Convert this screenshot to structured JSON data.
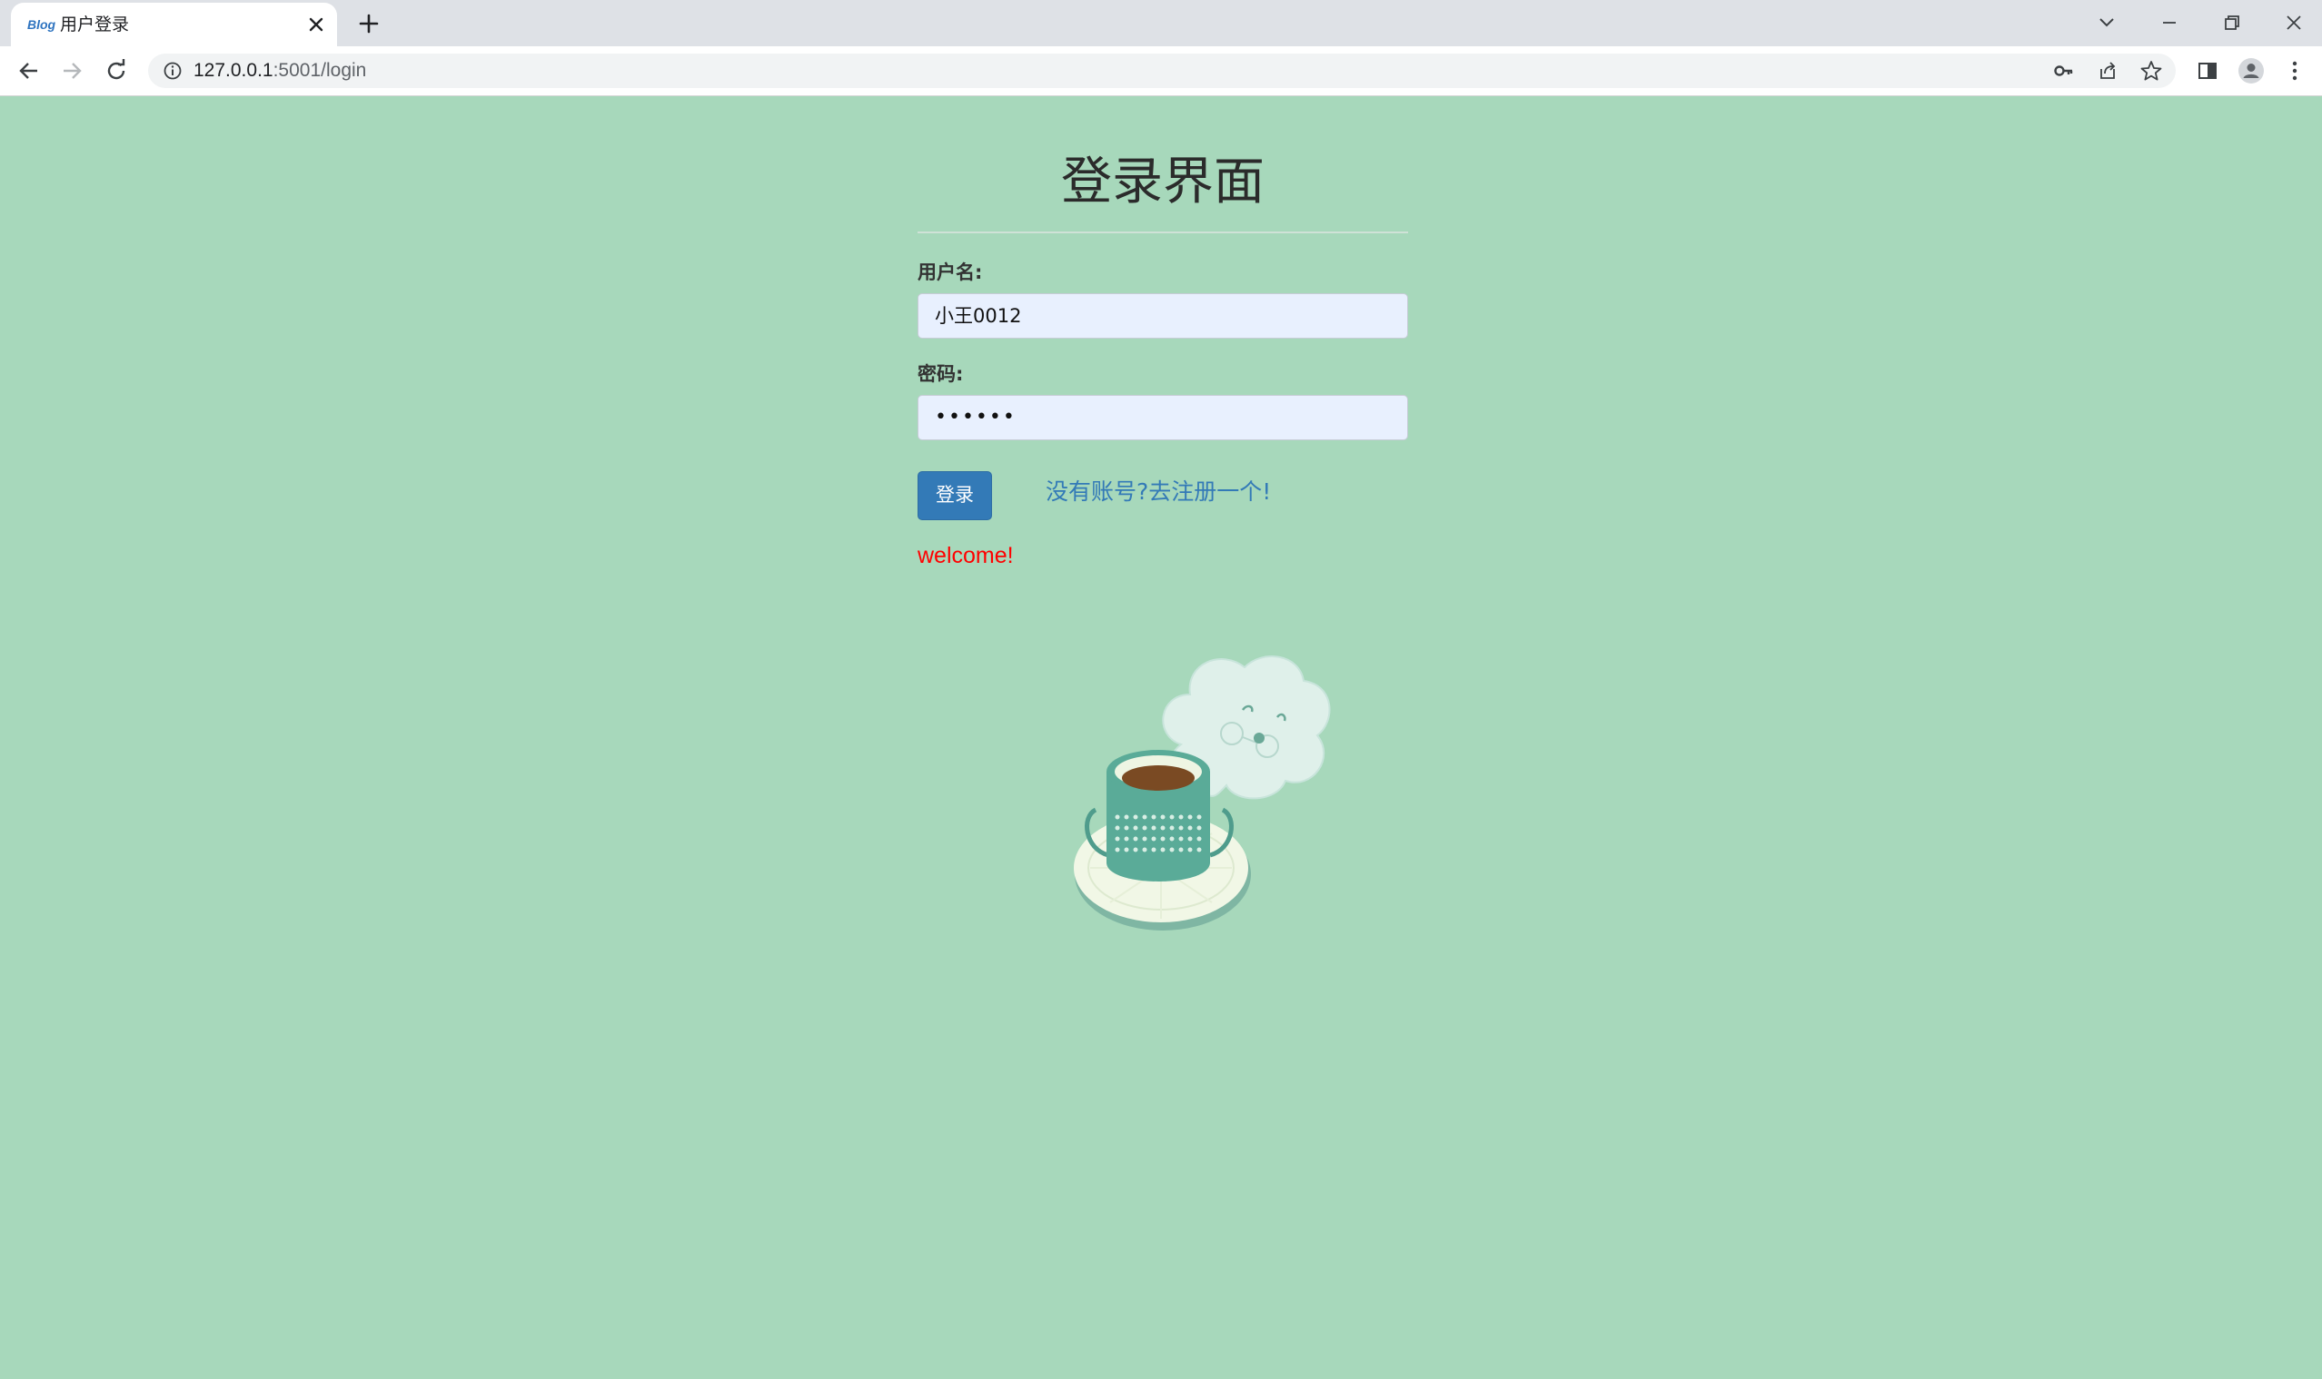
{
  "browser": {
    "tab": {
      "favicon_text": "Blog",
      "title": "用户登录"
    },
    "url": {
      "host": "127.0.0.1",
      "path": ":5001/login"
    }
  },
  "page": {
    "title": "登录界面",
    "username_label": "用户名:",
    "username_value": "小王0012",
    "password_label": "密码:",
    "password_value": "••••••",
    "login_button": "登录",
    "register_link": "没有账号?去注册一个!",
    "message": "welcome!"
  },
  "colors": {
    "background": "#a7d8bb",
    "primary_button": "#337ab7",
    "link": "#337ab7",
    "message": "#ff0000"
  },
  "icons": [
    "info-icon",
    "key-icon",
    "share-icon",
    "star-icon",
    "side-panel-icon",
    "profile-icon",
    "menu-icon"
  ]
}
